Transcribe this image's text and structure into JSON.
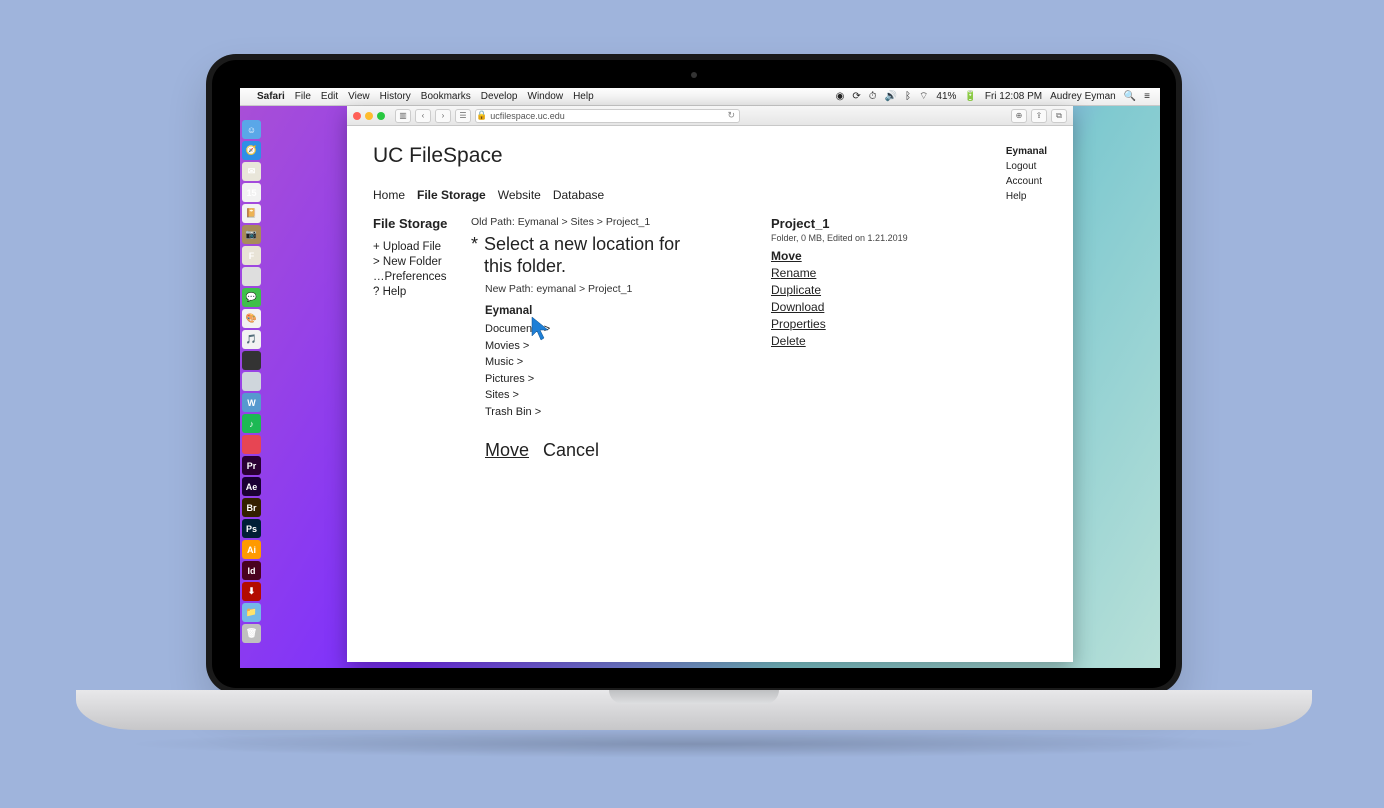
{
  "menubar": {
    "app": "Safari",
    "items": [
      "File",
      "Edit",
      "View",
      "History",
      "Bookmarks",
      "Develop",
      "Window",
      "Help"
    ],
    "battery": "41%",
    "clock": "Fri 12:08 PM",
    "user": "Audrey Eyman"
  },
  "toolbar": {
    "url_host": "ucfilespace.uc.edu"
  },
  "page": {
    "brand": "UC FileSpace",
    "user": {
      "name": "Eymanal",
      "links": [
        "Logout",
        "Account",
        "Help"
      ]
    },
    "tabs": [
      "Home",
      "File Storage",
      "Website",
      "Database"
    ],
    "active_tab": "File Storage",
    "left": {
      "heading": "File Storage",
      "links": [
        "+ Upload File",
        "> New Folder",
        "…Preferences",
        "? Help"
      ]
    },
    "mid": {
      "old_path": "Old Path: Eymanal > Sites > Project_1",
      "prompt": "Select a new location for this folder.",
      "new_path": "New Path: eymanal > Project_1",
      "root": "Eymanal",
      "dirs": [
        "Documents >",
        "Movies >",
        "Music >",
        "Pictures >",
        "Sites >",
        "Trash Bin >"
      ],
      "move": "Move",
      "cancel": "Cancel"
    },
    "right": {
      "title": "Project_1",
      "meta": "Folder, 0 MB, Edited on 1.21.2019",
      "ops": [
        "Move",
        "Rename",
        "Duplicate",
        "Download",
        "Properties",
        "Delete"
      ],
      "active_op": "Move"
    }
  },
  "dock": [
    {
      "bg": "#5aa7e8",
      "txt": "☺"
    },
    {
      "bg": "#2f8fe6",
      "txt": "🧭"
    },
    {
      "bg": "#e9e6da",
      "txt": "✉"
    },
    {
      "bg": "#f2f2f2",
      "txt": "15"
    },
    {
      "bg": "#f2f2f2",
      "txt": "📔"
    },
    {
      "bg": "#a88b5a",
      "txt": "📷"
    },
    {
      "bg": "#e8e3d6",
      "txt": "F"
    },
    {
      "bg": "#dedede",
      "txt": ""
    },
    {
      "bg": "#3fc04a",
      "txt": "💬"
    },
    {
      "bg": "#f2f2f2",
      "txt": "🎨"
    },
    {
      "bg": "#f2f2f2",
      "txt": "🎵"
    },
    {
      "bg": "#333",
      "txt": ""
    },
    {
      "bg": "#cfd6dc",
      "txt": ""
    },
    {
      "bg": "#5799cf",
      "txt": "W"
    },
    {
      "bg": "#1db954",
      "txt": "♪"
    },
    {
      "bg": "#e74553",
      "txt": ""
    },
    {
      "bg": "#2a0033",
      "txt": "Pr"
    },
    {
      "bg": "#1a0033",
      "txt": "Ae"
    },
    {
      "bg": "#332000",
      "txt": "Br"
    },
    {
      "bg": "#001e36",
      "txt": "Ps"
    },
    {
      "bg": "#ff9a00",
      "txt": "Ai"
    },
    {
      "bg": "#49021f",
      "txt": "Id"
    },
    {
      "bg": "#b30b00",
      "txt": "⬇"
    },
    {
      "bg": "#74b8e8",
      "txt": "📁"
    },
    {
      "bg": "#c0c0c0",
      "txt": "🗑"
    }
  ]
}
